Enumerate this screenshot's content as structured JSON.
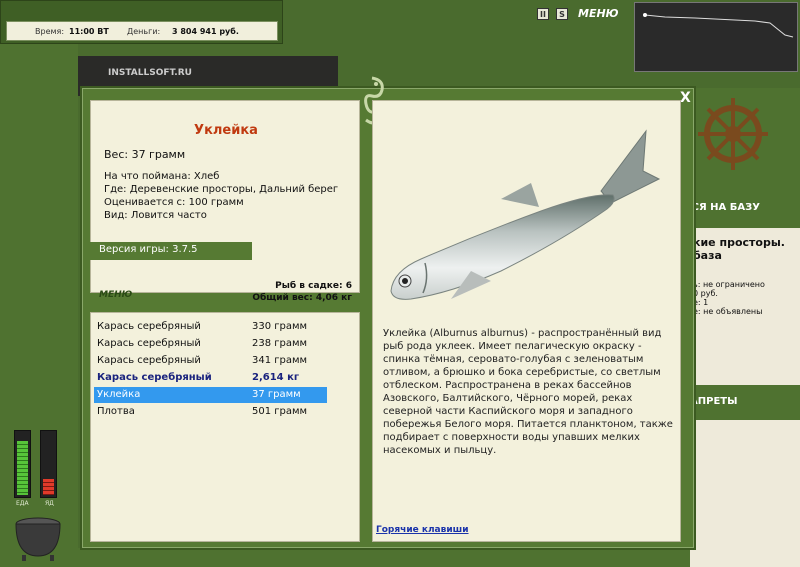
{
  "topbar": {
    "time_label": "Время:",
    "time_value": "11:00 ВТ",
    "money_label": "Деньги:",
    "money_value": "3 804 941 руб."
  },
  "top_right": {
    "pause_label": "II",
    "s_label": "S",
    "menu_label": "МЕНЮ"
  },
  "background": {
    "brand": "INSTALLSOFT.RU",
    "right_text_1": "ЬСЯ НА БАЗУ",
    "right_text_2": "кие просторы.",
    "right_text_3": "база",
    "right_text_4": "ь: не ограничено",
    "right_text_5": "0 руб.",
    "right_text_6": "е: 1",
    "right_text_7": "е: не объявлены",
    "right_text_8": "АПРЕТЫ"
  },
  "meters": {
    "food_label": "ЕДА",
    "poison_label": "ЯД",
    "food_level": 0.85,
    "poison_level": 0.25
  },
  "dialog": {
    "close_label": "X",
    "fish_name": "Уклейка",
    "weight": "Вес: 37 грамм",
    "caught_on": "На что поймана: Хлеб",
    "location": "Где: Деревенские просторы, Дальний берег",
    "rated_from": "Оценивается с: 100 грамм",
    "type": "Вид: Ловится часто",
    "version": "Версия игры: 3.7.5",
    "menu_label": "МЕНЮ",
    "fish_in_cage": "Рыб в садке: 6",
    "total_weight": "Общий вес: 4,06 кг",
    "catch_list": [
      {
        "name": "Карась серебряный",
        "weight": "330 грамм"
      },
      {
        "name": "Карась серебряный",
        "weight": "238 грамм"
      },
      {
        "name": "Карась серебряный",
        "weight": "341 грамм"
      },
      {
        "name": "Карась серебряный",
        "weight": "2,614 кг"
      },
      {
        "name": "Уклейка",
        "weight": "37 грамм"
      },
      {
        "name": "Плотва",
        "weight": "501 грамм"
      }
    ],
    "description": "Уклейка (Alburnus alburnus) - распространённый вид рыб рода уклеек. Имеет пелагическую окраску - спинка тёмная, серовато-голубая с зеленоватым отливом, а брюшко и бока серебристые, со светлым отблеском. Распространена в реках бассейнов Азовского, Балтийского, Чёрного морей, реках северной части Каспийского моря и западного побережья Белого моря. Питается планктоном, также подбирает с поверхности воды упавших мелких насекомых и пыльцу.",
    "hotkeys": "Горячие клавиши"
  },
  "colors": {
    "frame_green": "#567a33",
    "panel_beige": "#f3f1dc",
    "title_red": "#c03a10",
    "selection_blue": "#3399ee"
  }
}
